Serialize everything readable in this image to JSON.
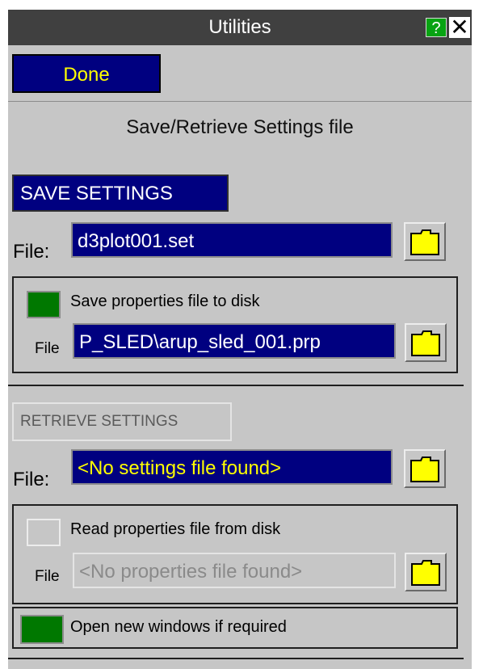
{
  "window": {
    "title": "Utilities",
    "help_label": "?",
    "close_label": "✕"
  },
  "toolbar": {
    "done_label": "Done"
  },
  "heading": "Save/Retrieve Settings file",
  "save": {
    "button_label": "SAVE SETTINGS",
    "file_label": "File:",
    "file_value": "d3plot001.set",
    "properties": {
      "checkbox_label": "Save properties file to disk",
      "checked": true,
      "file_label": "File",
      "file_value": "P_SLED\\arup_sled_001.prp"
    }
  },
  "retrieve": {
    "button_label": "RETRIEVE SETTINGS",
    "file_label": "File:",
    "file_value": "<No settings file found>",
    "properties": {
      "checkbox_label": "Read properties file from disk",
      "checked": false,
      "file_label": "File",
      "file_value": "<No properties file found>"
    }
  },
  "options": {
    "open_windows_label": "Open new windows if required",
    "open_windows_checked": true
  },
  "colors": {
    "panel": "#c6c6c6",
    "titlebar": "#404040",
    "accent_blue": "#000080",
    "check_green": "#007800",
    "folder_yellow": "#ffff00"
  },
  "icons": {
    "folder": "folder-icon",
    "help": "help-icon",
    "close": "close-icon"
  }
}
